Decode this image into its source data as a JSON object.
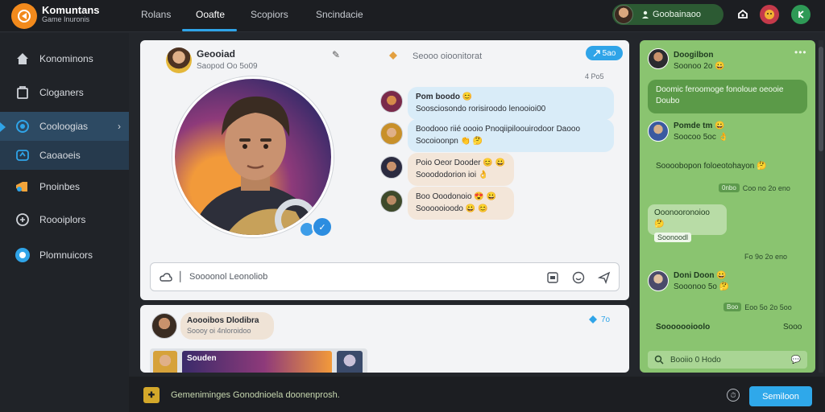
{
  "app": {
    "title": "Komuntans",
    "subtitle": "Game Inuronis"
  },
  "nav": {
    "tabs": [
      {
        "label": "Rolans"
      },
      {
        "label": "Ooafte"
      },
      {
        "label": "Scopiors"
      },
      {
        "label": "Sncindacie"
      }
    ],
    "active_tab": 1
  },
  "user": {
    "name": "Goobainaoo"
  },
  "sidebar": {
    "items": [
      {
        "label": "Konominons",
        "icon": "home-icon"
      },
      {
        "label": "Cloganers",
        "icon": "folder-icon"
      },
      {
        "label": "Cooloogias",
        "icon": "chat-icon"
      },
      {
        "label": "Caoaoeis",
        "icon": "game-icon"
      },
      {
        "label": "Pnoinbes",
        "icon": "megaphone-icon"
      },
      {
        "label": "Roooiplors",
        "icon": "controller-icon"
      },
      {
        "label": "Plomnuicors",
        "icon": "globe-icon"
      }
    ]
  },
  "profile": {
    "name": "Geooiad",
    "meta": "Saopod Oo 5o09",
    "status": "Seooo oioonitorat",
    "chip": "5ao",
    "time_label": "4 Po5"
  },
  "messages": [
    {
      "line1": "Pom boodo 😊",
      "line2": "Soosciosondo rorisiroodo lenooioi00"
    },
    {
      "line1": "Boodooo riié oooio Pnoqiipiloouirodoor Daooo",
      "line2": "Socoioonpn 👏 🤔"
    },
    {
      "line1": "Poio Oeor Dooder 😊 😀",
      "line2": "Sooododorion ioi 👌"
    },
    {
      "line1": "Boo Ooodonoio 😍 😀",
      "line2": "Soooooioodo 😀 😊"
    }
  ],
  "composer": {
    "placeholder": "Soooonol Leonoliob"
  },
  "post": {
    "name": "Aoooibos Dlodibra",
    "meta": "Soooy oi 4nloroidoo",
    "banner_title": "Souden",
    "badge": "7o"
  },
  "right_panel": {
    "entries": [
      {
        "name": "Doogilbon",
        "sub": "Soonoo 2o 😀"
      },
      {
        "text": "Doomic feroomoge fonoloue oeooie Doubo"
      },
      {
        "name": "Pomde tm 😀",
        "sub": "Soocoo 5oc 👌"
      },
      {
        "text": "Soooobopon foloeotohayon 🤔"
      },
      {
        "stamp_tag": "0nbo",
        "stamp": "Coo no 2o eno"
      },
      {
        "text": "Ooonooronoioo 🤔",
        "sub": "Soonoodl"
      },
      {
        "stamp": "Fo 9o 2o eno"
      },
      {
        "name": "Doni Doon 😀",
        "sub": "Sooonoo 5o 🤔"
      },
      {
        "stamp_tag": "Boo",
        "stamp": "Eoo 5o 2o 5oo"
      },
      {
        "name": "Sooooooioolo",
        "sub": "Sooo"
      }
    ],
    "search_placeholder": "Booiio 0 Hodo"
  },
  "bottom_bar": {
    "input_text": "Gemeniminges Gonodnioela doonenprosh.",
    "send_label": "Semiloon"
  },
  "colors": {
    "accent": "#2fa4e8",
    "panel_green": "#8ac470",
    "topbar": "#1c1e22",
    "sidebar": "#202328"
  }
}
